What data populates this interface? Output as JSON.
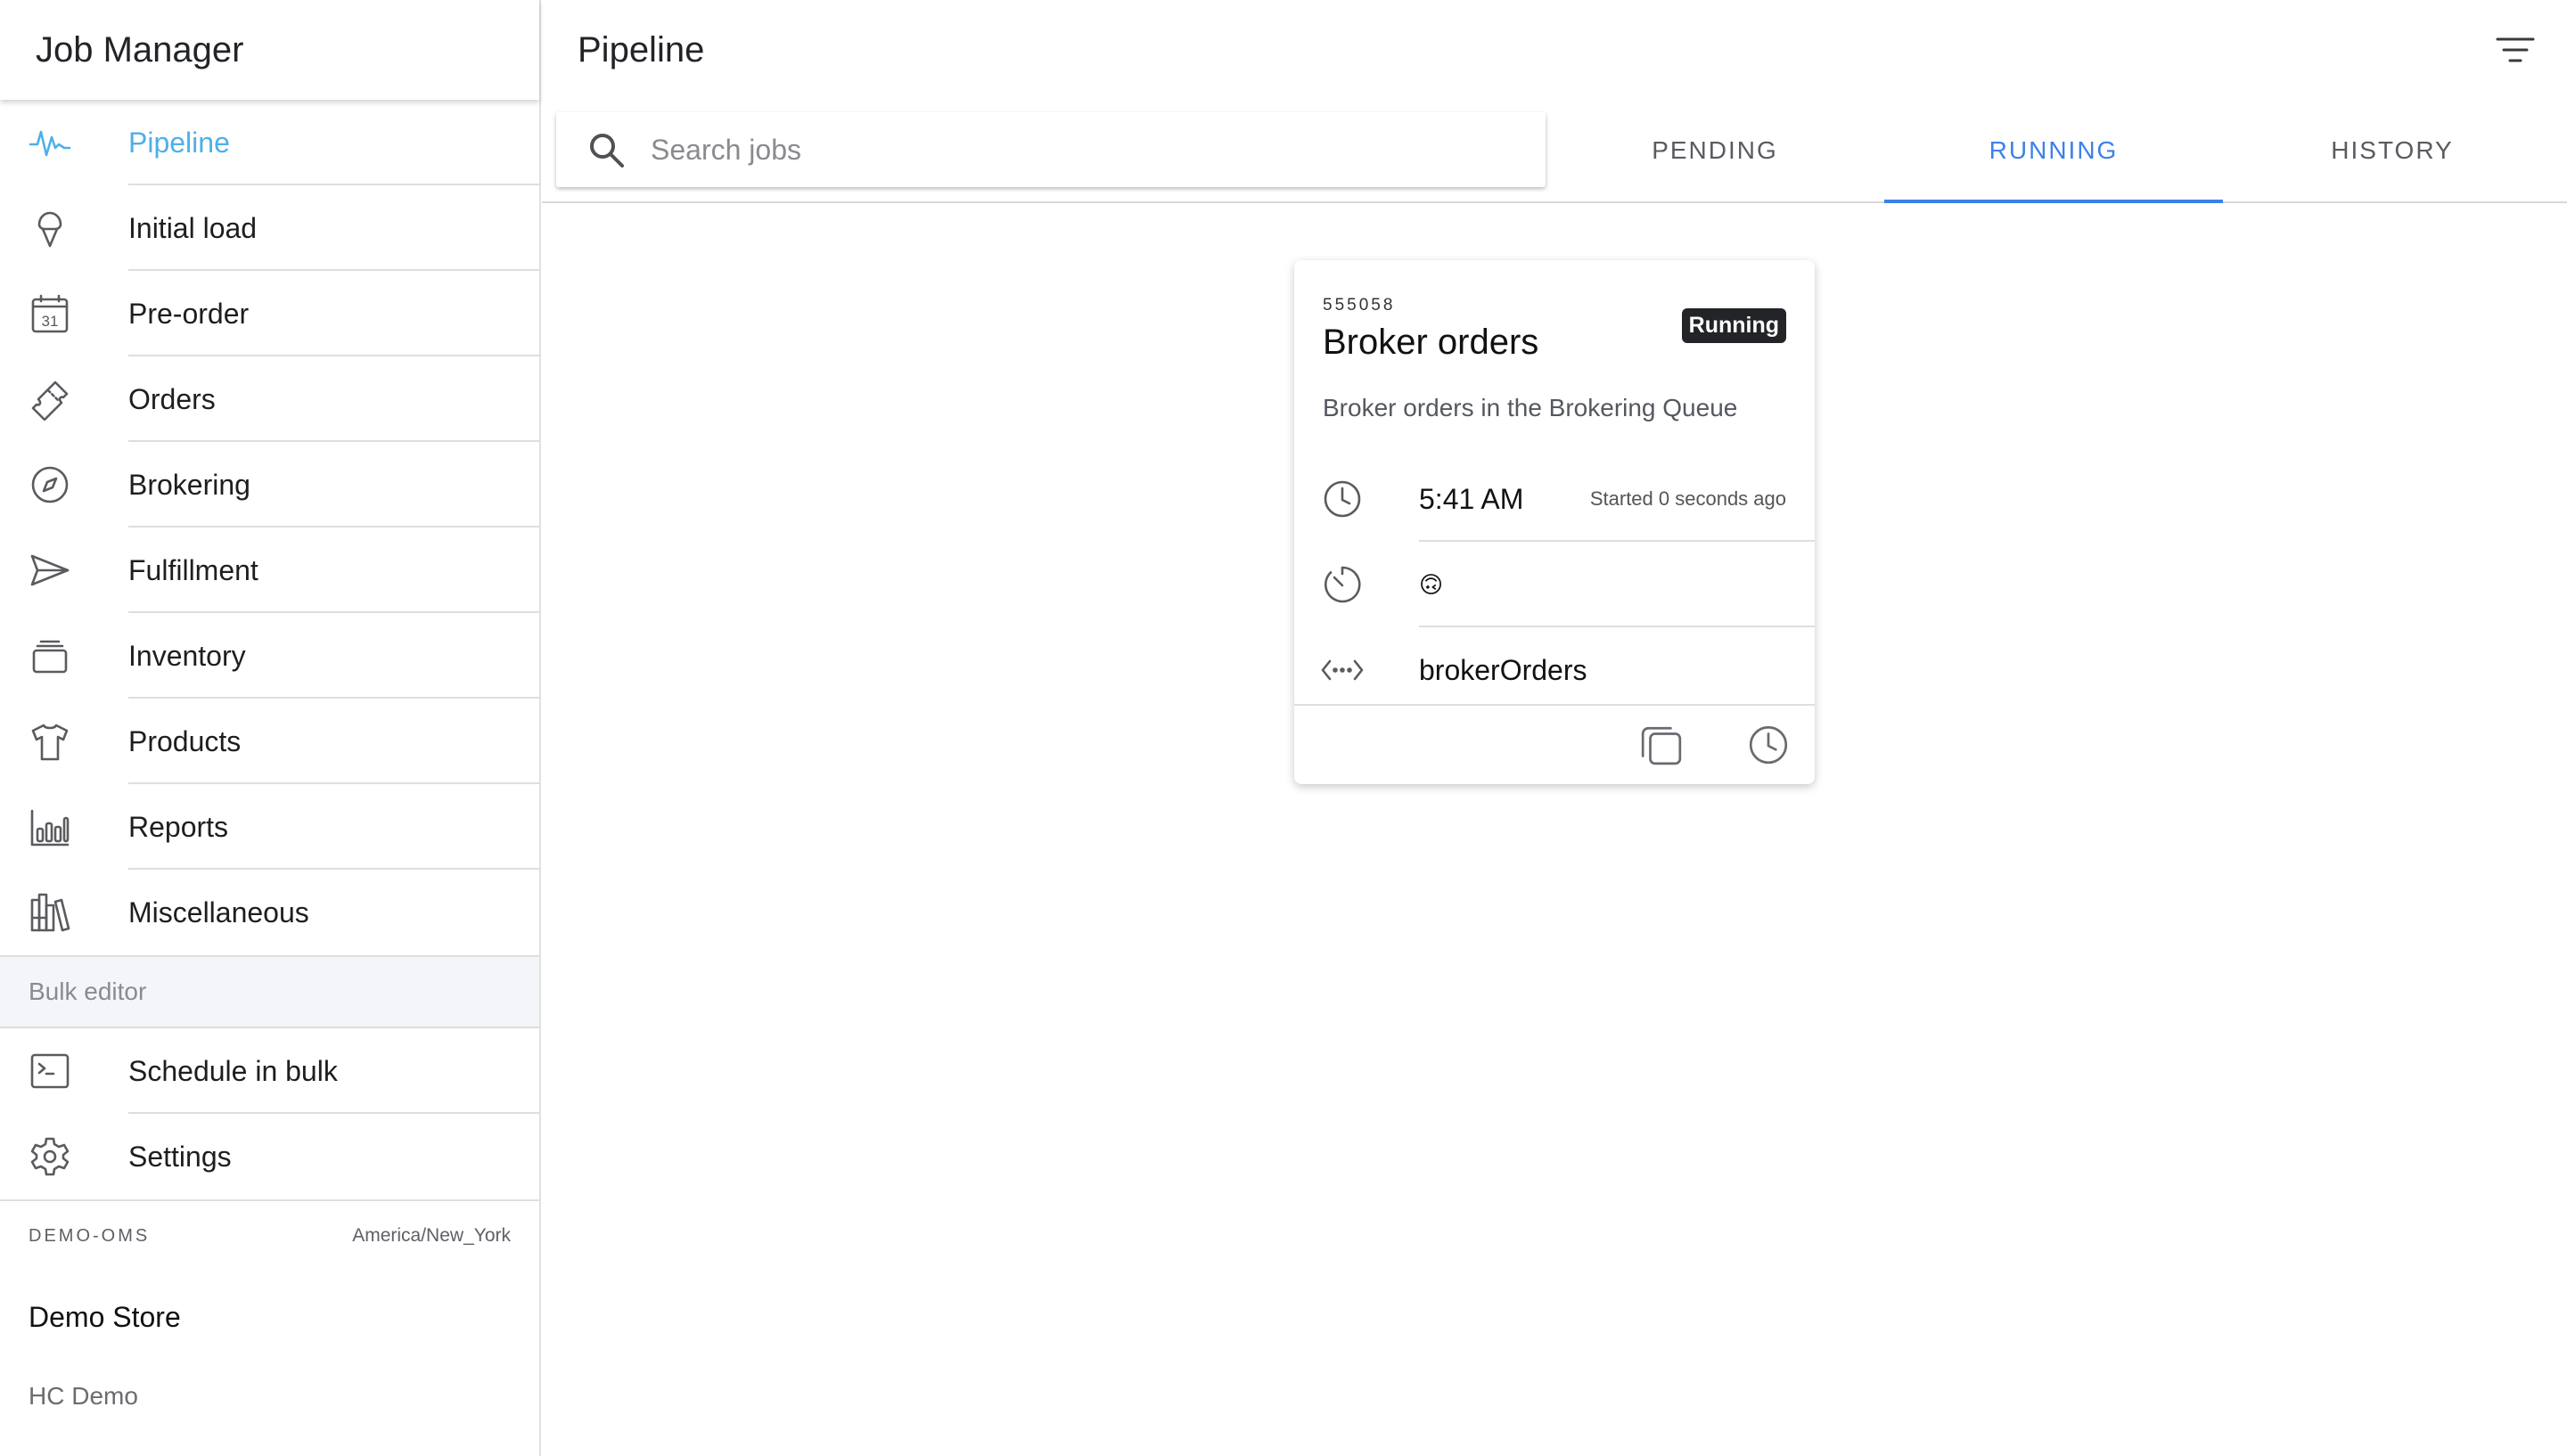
{
  "app": {
    "title": "Job Manager"
  },
  "sidebar": {
    "items": [
      {
        "label": "Pipeline",
        "icon": "pulse-icon",
        "active": true
      },
      {
        "label": "Initial load",
        "icon": "ice-cream-icon"
      },
      {
        "label": "Pre-order",
        "icon": "calendar-icon",
        "calendar_day": "31"
      },
      {
        "label": "Orders",
        "icon": "ticket-icon"
      },
      {
        "label": "Brokering",
        "icon": "compass-icon"
      },
      {
        "label": "Fulfillment",
        "icon": "send-icon"
      },
      {
        "label": "Inventory",
        "icon": "albums-icon"
      },
      {
        "label": "Products",
        "icon": "shirt-icon"
      },
      {
        "label": "Reports",
        "icon": "bar-chart-icon"
      },
      {
        "label": "Miscellaneous",
        "icon": "library-icon"
      }
    ],
    "section_label": "Bulk editor",
    "bulk_items": [
      {
        "label": "Schedule in bulk",
        "icon": "terminal-icon"
      },
      {
        "label": "Settings",
        "icon": "settings-icon"
      }
    ],
    "footer": {
      "instance": "DEMO-OMS",
      "timezone": "America/New_York",
      "store": "Demo Store",
      "store_sub": "HC Demo"
    }
  },
  "main": {
    "title": "Pipeline",
    "search": {
      "placeholder": "Search jobs",
      "value": ""
    },
    "tabs": [
      {
        "label": "PENDING"
      },
      {
        "label": "RUNNING",
        "active": true
      },
      {
        "label": "HISTORY"
      }
    ]
  },
  "job": {
    "id": "555058",
    "title": "Broker orders",
    "status": "Running",
    "description": "Broker orders in the Brokering Queue",
    "time": "5:41 AM",
    "time_note": "Started 0 seconds ago",
    "frequency_emoji": "🙃",
    "service": "brokerOrders"
  },
  "colors": {
    "accent": "#3b82e6",
    "active_nav": "#4eb0e8",
    "badge_bg": "#222428"
  }
}
